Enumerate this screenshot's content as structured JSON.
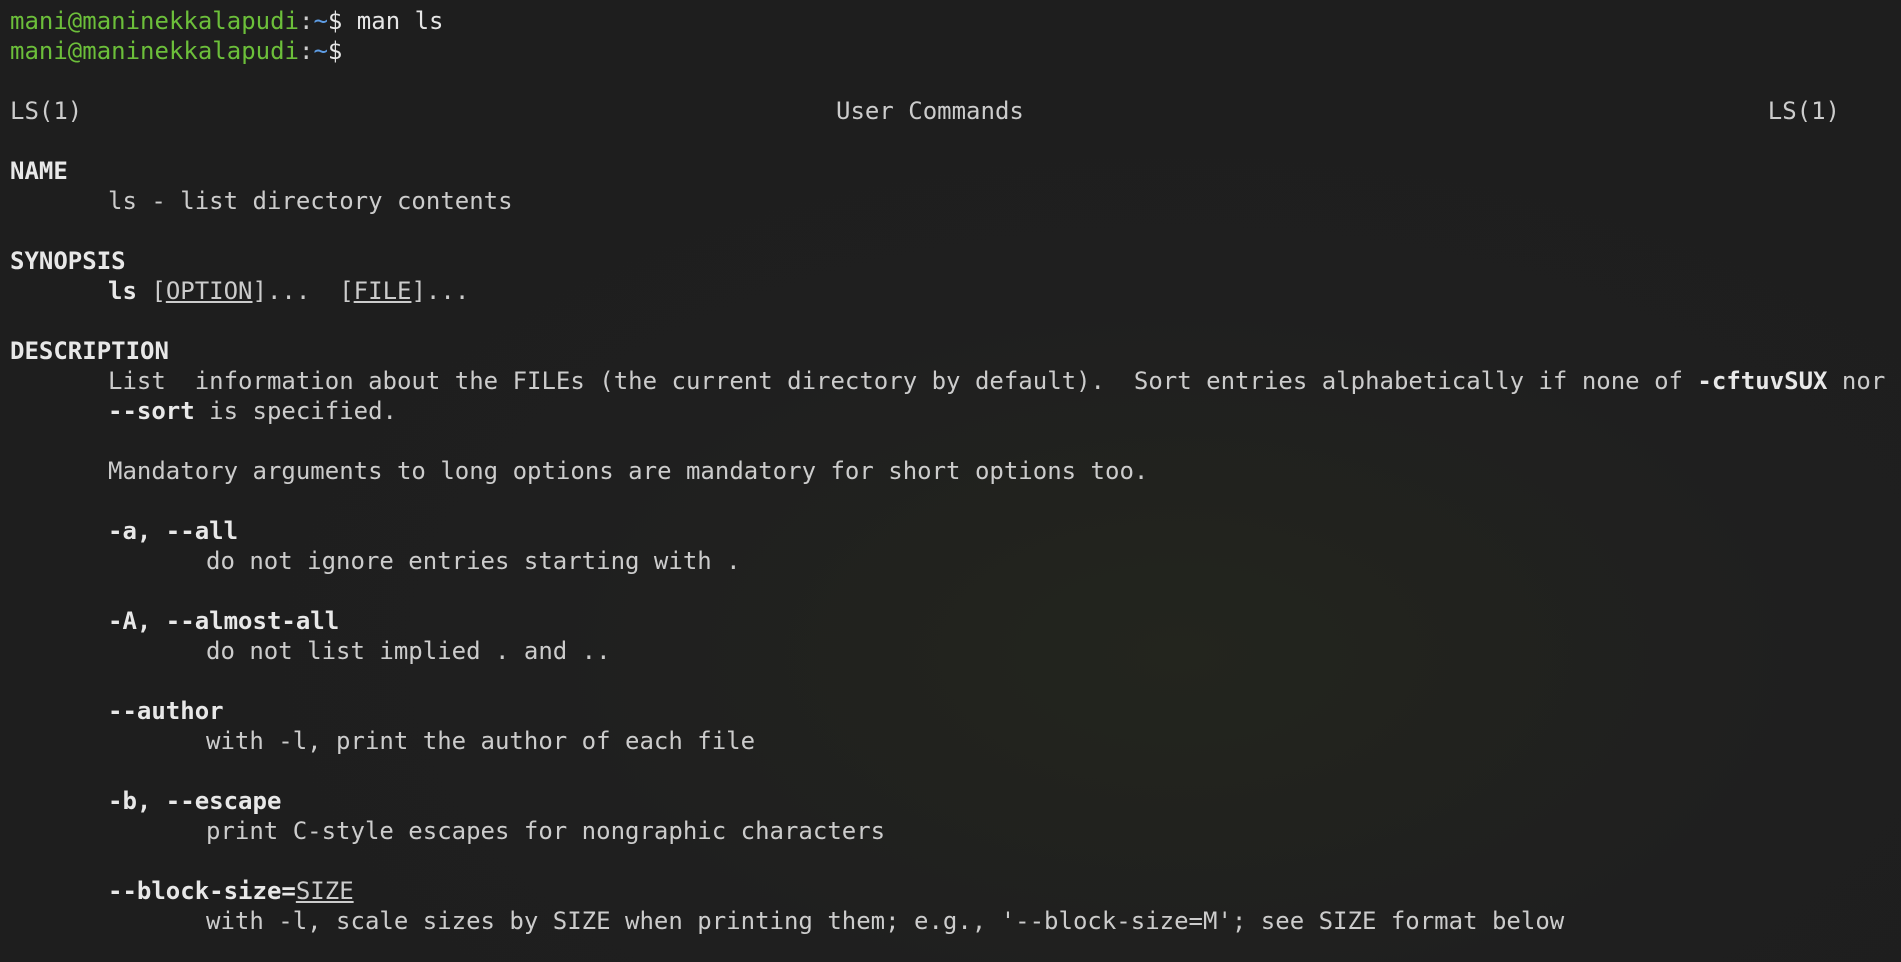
{
  "prompt": {
    "user_host": "mani@maninekkalapudi",
    "colon": ":",
    "path": "~",
    "dollar": "$ ",
    "command": "man ls"
  },
  "man": {
    "header_left": "LS(1)",
    "header_center": "User Commands",
    "header_right": "LS(1)",
    "name_heading": "NAME",
    "name_desc": "ls - list directory contents",
    "synopsis_heading": "SYNOPSIS",
    "synopsis": {
      "cmd": "ls",
      "open1": " [",
      "option": "OPTION",
      "close1": "]...  [",
      "file": "FILE",
      "close2": "]..."
    },
    "description_heading": "DESCRIPTION",
    "desc_line1_pre": "List  information about the FILEs (the current directory by default).  Sort entries alphabetically if none of ",
    "desc_line1_flag": "-cftuvSUX",
    "desc_line1_post": " nor",
    "desc_line2_flag": "--sort",
    "desc_line2_post": " is specified.",
    "mandatory": "Mandatory arguments to long options are mandatory for short options too.",
    "options": [
      {
        "flag": "-a, --all",
        "desc": "do not ignore entries starting with ."
      },
      {
        "flag": "-A, --almost-all",
        "desc": "do not list implied . and .."
      },
      {
        "flag": "--author",
        "desc": "with -l, print the author of each file"
      },
      {
        "flag": "-b, --escape",
        "desc": "print C-style escapes for nongraphic characters"
      }
    ],
    "block_size": {
      "flag": "--block-size=",
      "arg": "SIZE",
      "desc": "with -l, scale sizes by SIZE when printing them; e.g., '--block-size=M'; see SIZE format below"
    }
  }
}
